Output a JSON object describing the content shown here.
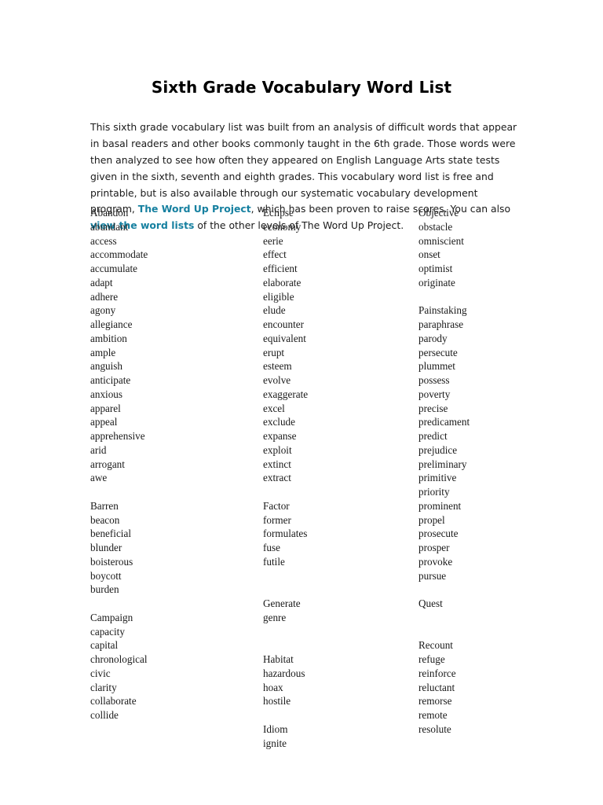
{
  "document": {
    "title": "Sixth Grade Vocabulary Word List",
    "intro": {
      "part1": "This sixth grade vocabulary list was built from an analysis of difficult words that appear in basal readers and other books commonly taught in the 6th grade. Those words were then analyzed to see how often they appeared on English Language Arts state tests given in the sixth, seventh and eighth grades. This vocabulary word list is free and printable, but is also available through our systematic vocabulary development program, ",
      "link1": "The Word Up Project",
      "part2": ", which has been proven to raise scores. You can also ",
      "link2": "view the word lists",
      "part3": " of the other levels of The Word Up Project."
    },
    "link_color": "#1680a0"
  },
  "columns": [
    {
      "name": "column-1",
      "words": [
        "Abandon",
        "abundant",
        "access",
        "accommodate",
        "accumulate",
        "adapt",
        "adhere",
        "agony",
        "allegiance",
        "ambition",
        "ample",
        "anguish",
        "anticipate",
        "anxious",
        "apparel",
        "appeal",
        "apprehensive",
        "arid",
        "arrogant",
        "awe",
        "",
        "Barren",
        "beacon",
        "beneficial",
        "blunder",
        "boisterous",
        "boycott",
        "burden",
        "",
        "Campaign",
        "capacity",
        "capital",
        "chronological",
        "civic",
        "clarity",
        "collaborate",
        "collide"
      ]
    },
    {
      "name": "column-2",
      "words": [
        "Eclipse",
        "economy",
        "eerie",
        "effect",
        "efficient",
        "elaborate",
        "eligible",
        "elude",
        "encounter",
        "equivalent",
        "erupt",
        "esteem",
        "evolve",
        "exaggerate",
        "excel",
        "exclude",
        "expanse",
        "exploit",
        "extinct",
        "extract",
        "",
        "Factor",
        "former",
        "formulates",
        "fuse",
        "futile",
        "",
        "",
        "Generate",
        "genre",
        "",
        "",
        "Habitat",
        "hazardous",
        "hoax",
        "hostile",
        "",
        "Idiom",
        "ignite"
      ]
    },
    {
      "name": "column-3",
      "words": [
        "Objective",
        "obstacle",
        "omniscient",
        "onset",
        "optimist",
        "originate",
        "",
        "Painstaking",
        "paraphrase",
        "parody",
        "persecute",
        "plummet",
        "possess",
        "poverty",
        "precise",
        "predicament",
        "predict",
        "prejudice",
        "preliminary",
        "primitive",
        "priority",
        "prominent",
        "propel",
        "prosecute",
        "prosper",
        "provoke",
        "pursue",
        "",
        "Quest",
        "",
        "",
        "Recount",
        "refuge",
        "reinforce",
        "reluctant",
        "remorse",
        "remote",
        "resolute"
      ]
    }
  ]
}
